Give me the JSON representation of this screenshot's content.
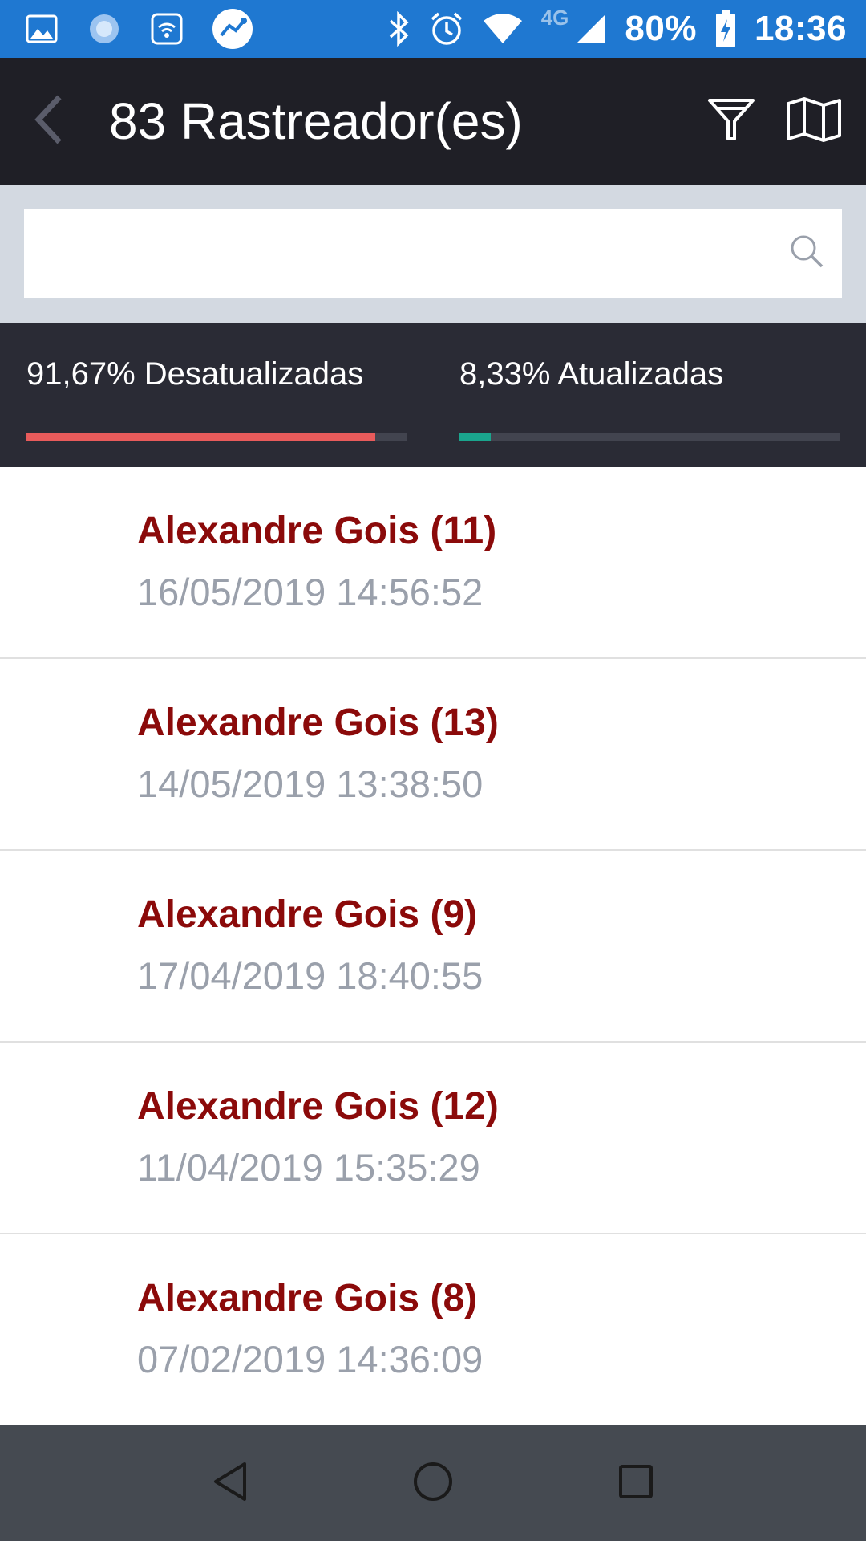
{
  "status_bar": {
    "network": "4G",
    "battery": "80%",
    "time": "18:36",
    "icons": [
      "gallery-icon",
      "loading-icon",
      "wifi-call-icon",
      "app-icon",
      "bluetooth-icon",
      "alarm-icon",
      "wifi-icon",
      "signal-icon",
      "battery-charging-icon"
    ]
  },
  "app_bar": {
    "title": "83 Rastreador(es)",
    "back_icon": "chevron-left-icon",
    "actions": [
      "filter-icon",
      "map-icon"
    ]
  },
  "search": {
    "value": "",
    "placeholder": "",
    "icon": "search-icon"
  },
  "stats": {
    "outdated_label": "91,67% Desatualizadas",
    "outdated_fraction": 0.9167,
    "outdated_color": "#e85b5b",
    "updated_label": "8,33% Atualizadas",
    "updated_fraction": 0.0833,
    "updated_color": "#1aa58d",
    "track_color": "#42444f"
  },
  "trackers": [
    {
      "name": "Alexandre Gois (11)",
      "date": "16/05/2019 14:56:52"
    },
    {
      "name": "Alexandre Gois (13)",
      "date": "14/05/2019 13:38:50"
    },
    {
      "name": "Alexandre Gois (9)",
      "date": "17/04/2019 18:40:55"
    },
    {
      "name": "Alexandre Gois (12)",
      "date": "11/04/2019 15:35:29"
    },
    {
      "name": "Alexandre Gois (8)",
      "date": "07/02/2019 14:36:09"
    }
  ],
  "colors": {
    "status_bar": "#1f78d1",
    "app_bar": "#1f1f26",
    "name_text": "#8b0a0a",
    "date_text": "#9aa0ab"
  },
  "nav_bar": [
    "back-triangle-icon",
    "home-circle-icon",
    "recents-square-icon"
  ]
}
